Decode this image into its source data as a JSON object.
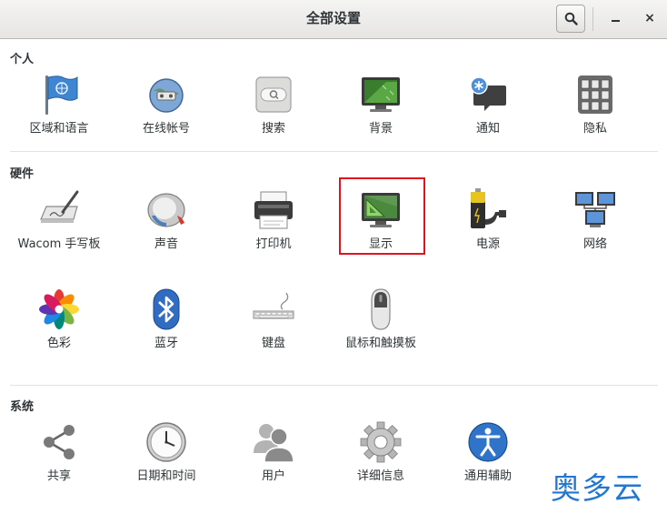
{
  "window": {
    "title": "全部设置",
    "search_icon": "search-icon",
    "minimize_icon": "minimize-icon",
    "close_label": "×"
  },
  "sections": {
    "personal": {
      "title": "个人",
      "items": [
        {
          "label": "区域和语言",
          "icon": "flag-globe-icon"
        },
        {
          "label": "在线帐号",
          "icon": "online-accounts-icon"
        },
        {
          "label": "搜索",
          "icon": "search-settings-icon"
        },
        {
          "label": "背景",
          "icon": "background-monitor-icon"
        },
        {
          "label": "通知",
          "icon": "notifications-icon"
        },
        {
          "label": "隐私",
          "icon": "privacy-lock-icon"
        }
      ]
    },
    "hardware": {
      "title": "硬件",
      "items": [
        {
          "label": "Wacom 手写板",
          "icon": "wacom-tablet-icon"
        },
        {
          "label": "声音",
          "icon": "speaker-icon"
        },
        {
          "label": "打印机",
          "icon": "printer-icon"
        },
        {
          "label": "显示",
          "icon": "display-monitor-icon"
        },
        {
          "label": "电源",
          "icon": "battery-plug-icon"
        },
        {
          "label": "网络",
          "icon": "network-computers-icon"
        },
        {
          "label": "色彩",
          "icon": "color-flower-icon"
        },
        {
          "label": "蓝牙",
          "icon": "bluetooth-icon"
        },
        {
          "label": "键盘",
          "icon": "keyboard-icon"
        },
        {
          "label": "鼠标和触摸板",
          "icon": "mouse-icon"
        }
      ]
    },
    "system": {
      "title": "系统",
      "items": [
        {
          "label": "共享",
          "icon": "share-icon"
        },
        {
          "label": "日期和时间",
          "icon": "clock-icon"
        },
        {
          "label": "用户",
          "icon": "users-icon"
        },
        {
          "label": "详细信息",
          "icon": "gear-icon"
        },
        {
          "label": "通用辅助",
          "icon": "accessibility-icon"
        }
      ]
    }
  },
  "watermark": "奥多云",
  "colors": {
    "highlight_border": "#e0141e",
    "watermark": "#2376d1"
  }
}
